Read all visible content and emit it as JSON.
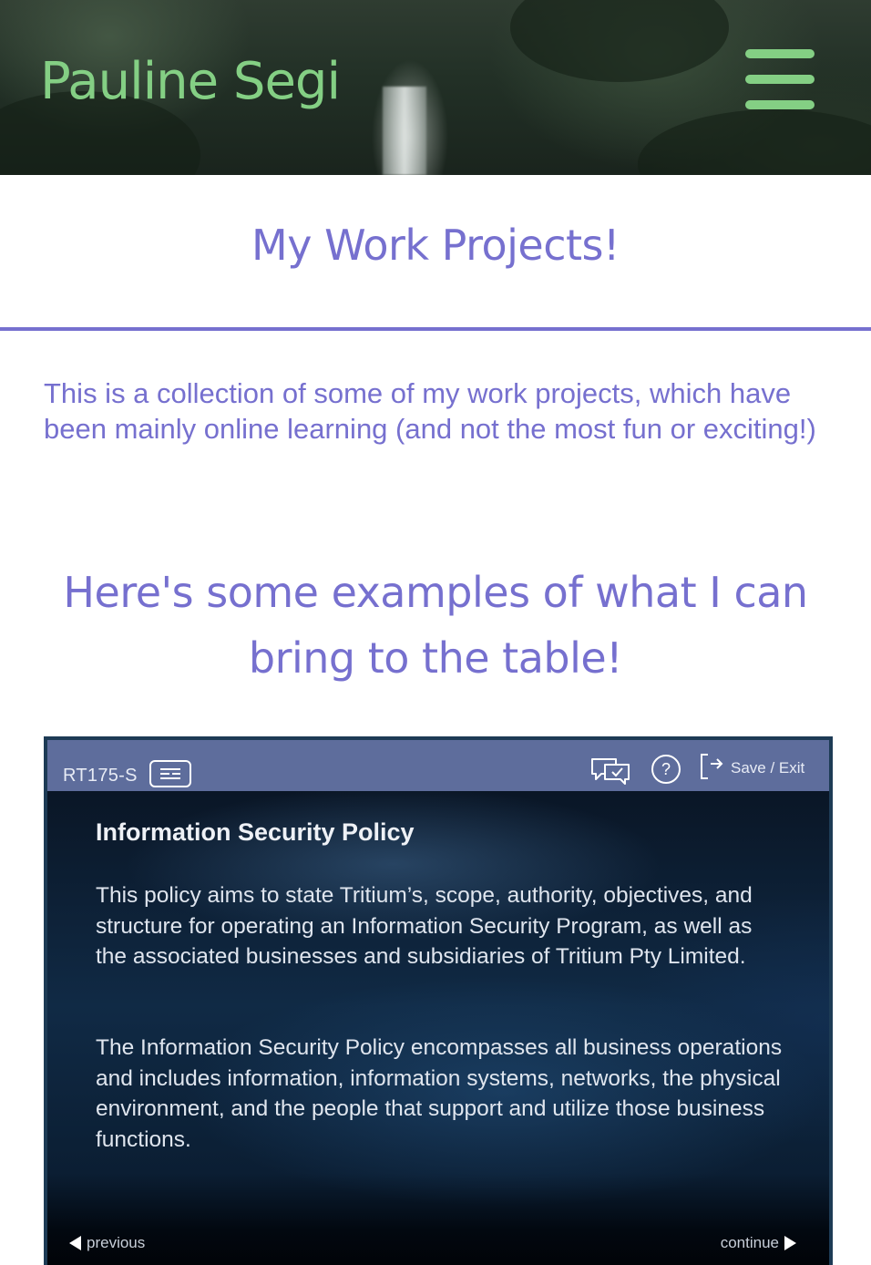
{
  "header": {
    "brand": "Pauline Segi",
    "menu_icon": "hamburger-menu-icon"
  },
  "main": {
    "title": "My Work Projects!",
    "intro": "This is a collection of some of my work projects, which have been mainly online learning (and not the most fun or exciting!)",
    "subheading": "Here's some examples of what I can bring to the table!"
  },
  "course": {
    "code": "RT175-S",
    "transcript_icon": "transcript-icon",
    "feedback_icon": "feedback-chat-icon",
    "help_icon": "help-icon",
    "exit_icon": "exit-icon",
    "save_exit_label": "Save / Exit",
    "slide_title": "Information Security Policy",
    "paragraphs": [
      "This policy aims to state Tritium’s, scope, authority, objectives, and structure for operating an Information Security Program, as well as the associated businesses and subsidiaries of Tritium Pty Limited.",
      "The Information Security Policy encompasses all business operations and includes information, information systems, networks, the physical environment, and the people that support and utilize those business functions."
    ],
    "previous_label": "previous",
    "continue_label": "continue"
  },
  "colors": {
    "brand_green": "#84cf84",
    "accent_purple": "#7670cf",
    "course_bar": "#5e6d9c"
  }
}
